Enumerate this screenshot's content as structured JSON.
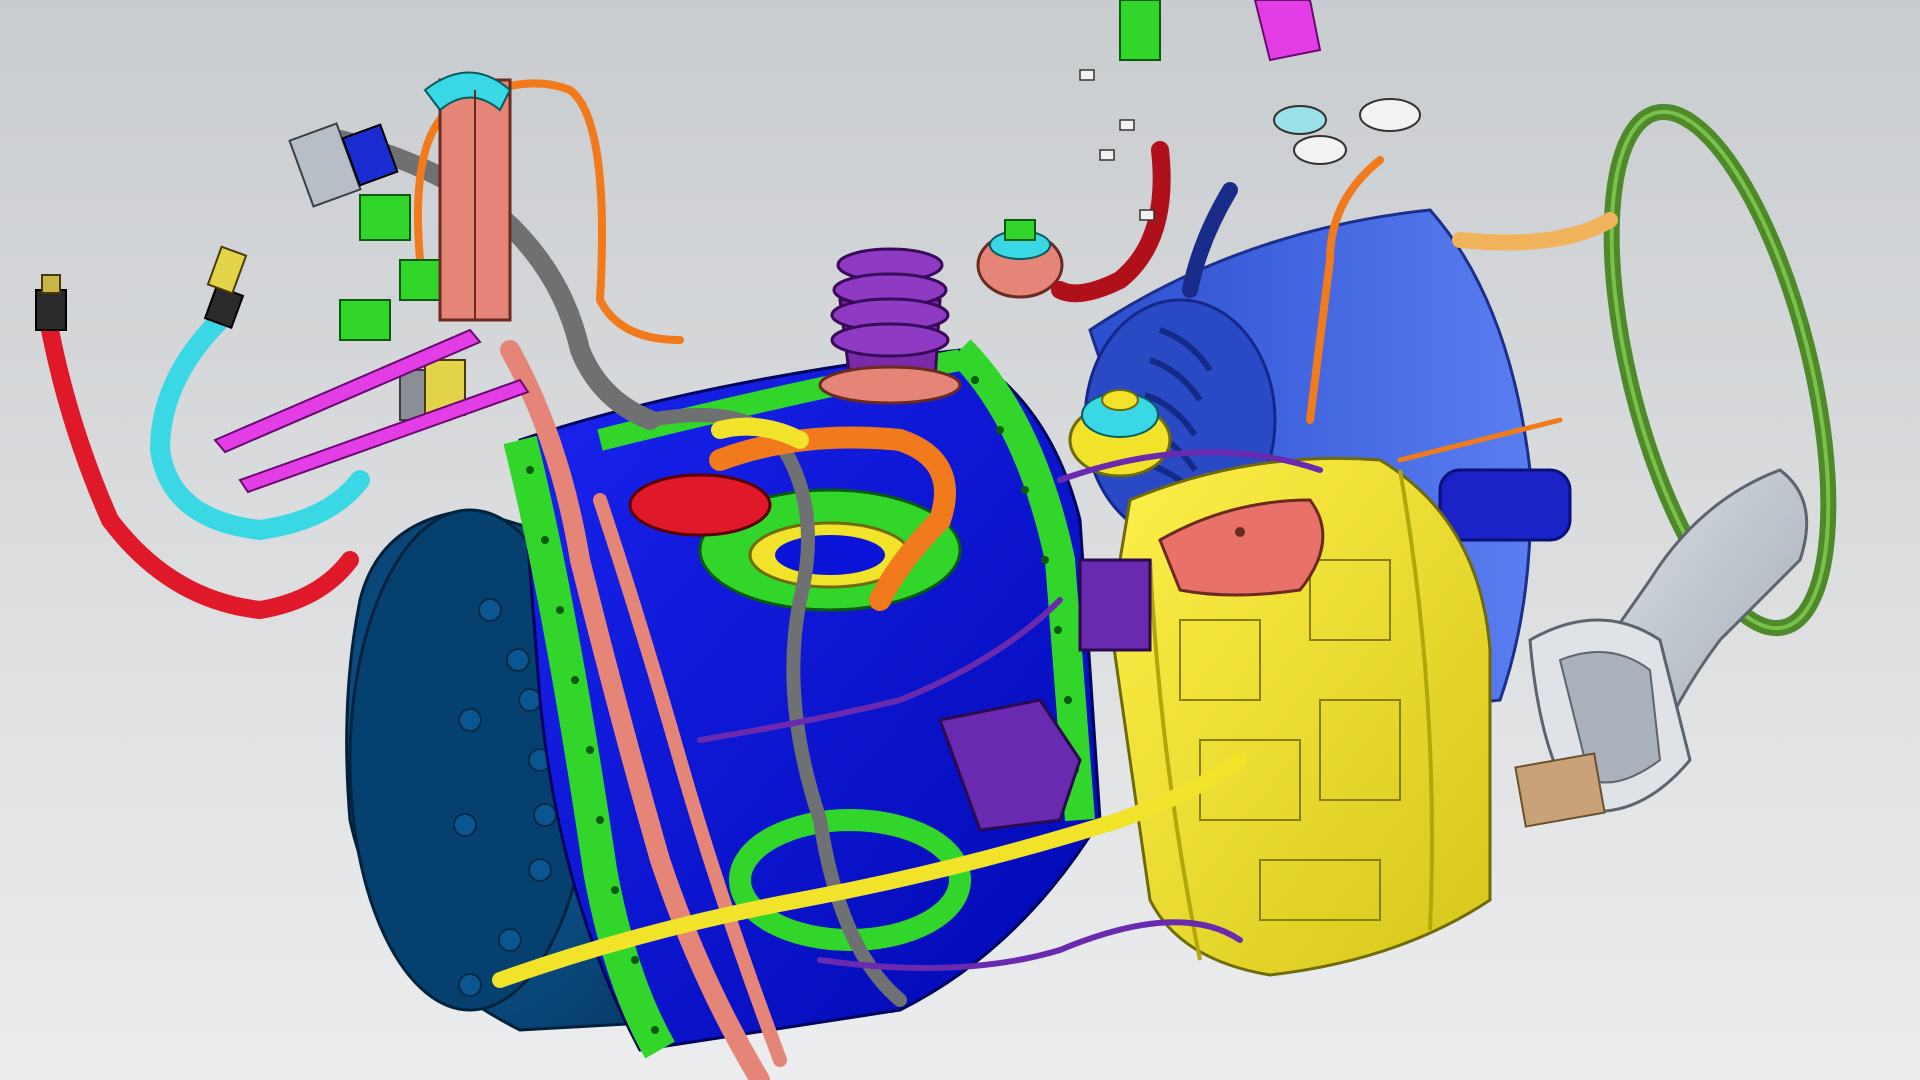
{
  "viewport": {
    "background_top": "#c9cccf",
    "background_bottom": "#ecedee"
  },
  "colors": {
    "casing_blue": "#0a14d8",
    "inlet_blue": "#0b4f86",
    "exhaust_blue": "#3a63d6",
    "gearbox_yellow": "#f1e32a",
    "flange_green": "#32d62a",
    "harness_red": "#e0192a",
    "harness_cyan": "#3ad7e4",
    "harness_salmon": "#e58577",
    "tube_orange": "#f07a1c",
    "tube_purple": "#6a2ab0",
    "tube_grey": "#6e7072",
    "ring_olive": "#4f8a2a",
    "bracket_magenta": "#e33ee6",
    "duct_grey": "#b8bec6"
  },
  "parts": [
    "inlet-cowl",
    "compressor-casing",
    "accessory-gearbox",
    "exhaust-casing",
    "exhaust-ring",
    "exhaust-duct-elbow",
    "wiring-harness",
    "fuel-lines",
    "oil-lines",
    "sensor-connectors"
  ]
}
